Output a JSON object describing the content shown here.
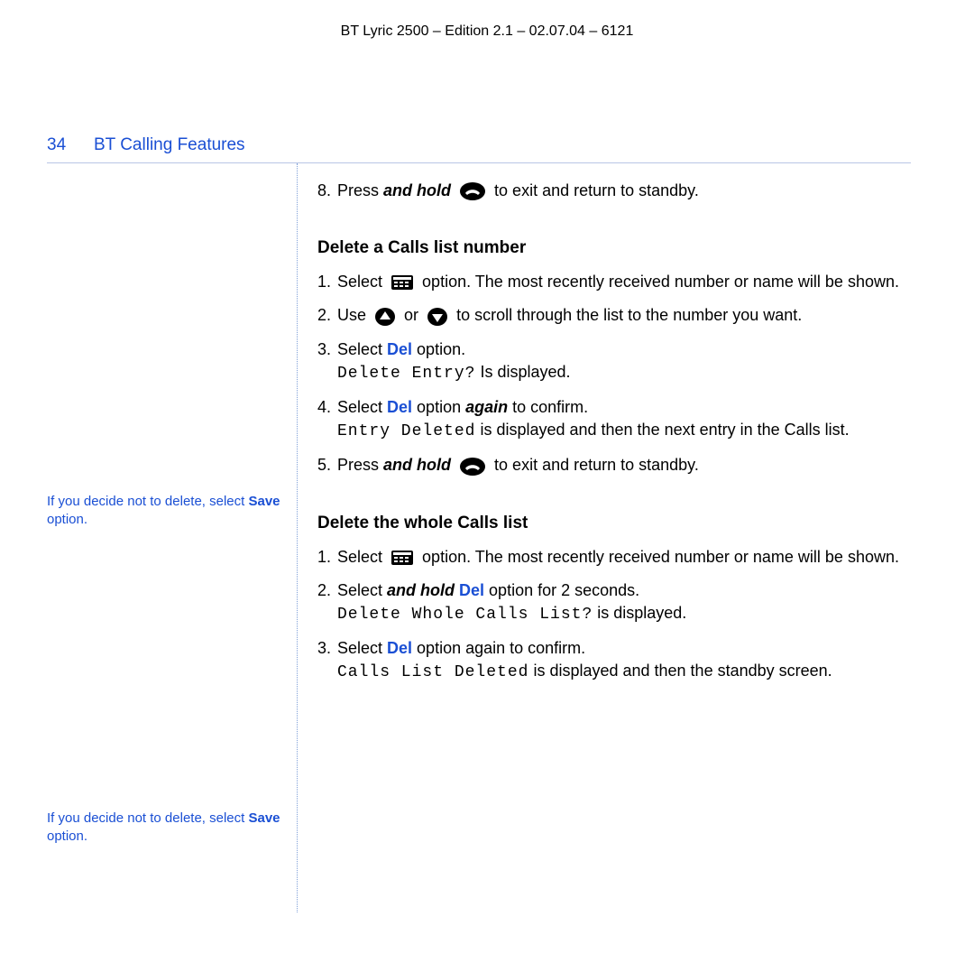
{
  "doc_id": "BT Lyric 2500 – Edition 2.1 – 02.07.04 – 6121",
  "page_number": "34",
  "section_title": "BT Calling Features",
  "notes": {
    "a_pre": "If you decide not to delete, select ",
    "a_bold": "Save",
    "a_post": " option.",
    "b_pre": "If you decide not to delete, select ",
    "b_bold": "Save",
    "b_post": " option."
  },
  "intro": {
    "num": "8.",
    "pre": "Press ",
    "bi": "and hold",
    "post": " to exit and return to standby."
  },
  "sec1": {
    "title": "Delete a Calls list number",
    "s1": {
      "num": "1.",
      "pre": "Select ",
      "post": " option. The most recently received number or name will be shown."
    },
    "s2": {
      "num": "2.",
      "pre": "Use ",
      "mid": " or ",
      "post": " to scroll through the list to the number you want."
    },
    "s3": {
      "num": "3.",
      "pre": "Select ",
      "link": "Del",
      "post": " option.",
      "lcd": "Delete Entry?",
      "tail": " Is displayed."
    },
    "s4": {
      "num": "4.",
      "pre": "Select ",
      "link": "Del",
      "mid": " option ",
      "bi": "again",
      "post": " to confirm.",
      "lcd": "Entry Deleted",
      "tail": " is displayed and then the next entry in the Calls list."
    },
    "s5": {
      "num": "5.",
      "pre": "Press ",
      "bi": "and hold",
      "post": " to exit and return to standby."
    }
  },
  "sec2": {
    "title": "Delete the whole Calls list",
    "s1": {
      "num": "1.",
      "pre": "Select ",
      "post": " option. The most recently received number or name will be shown."
    },
    "s2": {
      "num": "2.",
      "pre": "Select ",
      "bi": "and hold",
      "link": " Del",
      "post": " option for 2 seconds.",
      "lcd": "Delete Whole Calls List?",
      "tail": " is displayed."
    },
    "s3": {
      "num": "3.",
      "pre": "Select ",
      "link": "Del",
      "post": " option again to confirm.",
      "lcd": "Calls List Deleted",
      "tail": " is displayed and then the standby screen."
    }
  }
}
